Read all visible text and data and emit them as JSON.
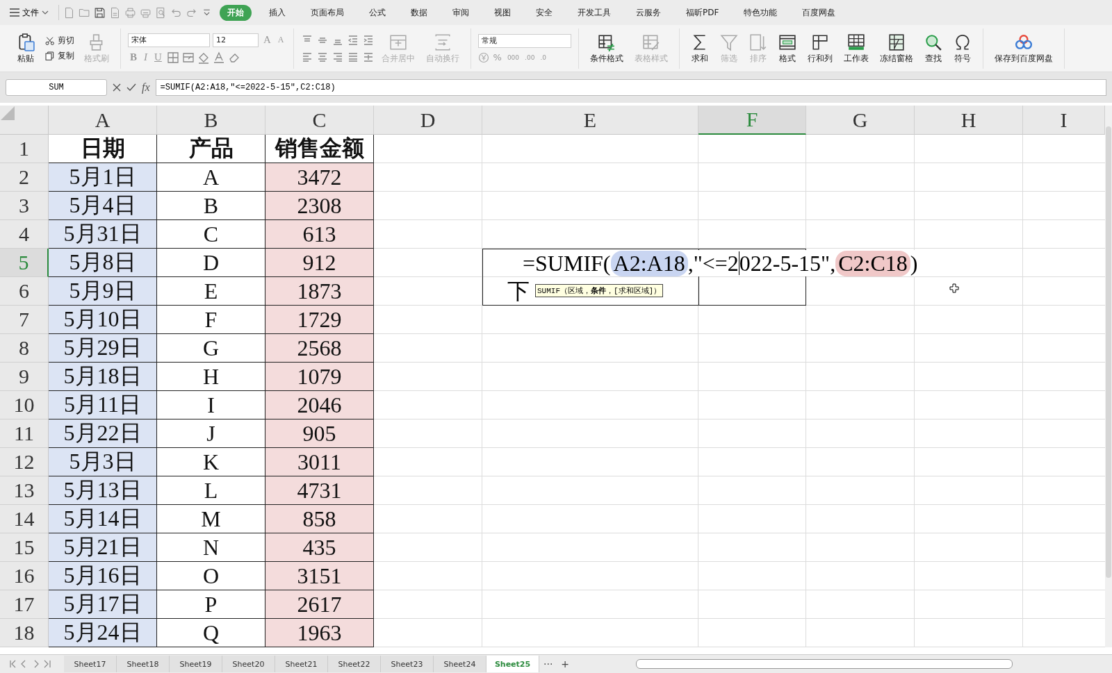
{
  "menu_bar": {
    "file_menu": "文件",
    "tabs": [
      {
        "label": "开始",
        "selected": true
      },
      {
        "label": "插入",
        "selected": false
      },
      {
        "label": "页面布局",
        "selected": false
      },
      {
        "label": "公式",
        "selected": false
      },
      {
        "label": "数据",
        "selected": false
      },
      {
        "label": "审阅",
        "selected": false
      },
      {
        "label": "视图",
        "selected": false
      },
      {
        "label": "安全",
        "selected": false
      },
      {
        "label": "开发工具",
        "selected": false
      },
      {
        "label": "云服务",
        "selected": false
      },
      {
        "label": "福昕PDF",
        "selected": false
      },
      {
        "label": "特色功能",
        "selected": false
      },
      {
        "label": "百度网盘",
        "selected": false
      }
    ]
  },
  "ribbon": {
    "paste": {
      "label": "粘贴",
      "kind": "paste",
      "disabled": false
    },
    "clipboard": [
      {
        "label": "剪切",
        "kind": "cut",
        "disabled": false
      },
      {
        "label": "复制",
        "kind": "copy",
        "disabled": false
      }
    ],
    "format_painter": {
      "label": "格式刷",
      "kind": "brush",
      "disabled": true
    },
    "font_name": "宋体",
    "font_size": "12",
    "grow_font": "A",
    "shrink_font": "A",
    "font_buttons": [
      {
        "label": "B",
        "kind": "bold"
      },
      {
        "label": "I",
        "kind": "italic"
      },
      {
        "label": "U",
        "kind": "underline"
      }
    ],
    "merge": [
      {
        "label": "合并居中",
        "kind": "merge",
        "disabled": true
      },
      {
        "label": "自动换行",
        "kind": "wrap",
        "disabled": true
      }
    ],
    "number_format": "常规",
    "percent": "%",
    "thousands": "000",
    "decimals_add": ".00",
    "decimals_remove": ".0",
    "big_buttons": [
      {
        "label": "条件格式",
        "kind": "condformat",
        "disabled": false
      },
      {
        "label": "表格样式",
        "kind": "tablestyle",
        "disabled": true
      },
      {
        "label": "求和",
        "kind": "sum",
        "disabled": false
      },
      {
        "label": "筛选",
        "kind": "filter",
        "disabled": true
      },
      {
        "label": "排序",
        "kind": "sort",
        "disabled": true
      },
      {
        "label": "格式",
        "kind": "format",
        "disabled": false
      },
      {
        "label": "行和列",
        "kind": "rowcol",
        "disabled": false
      },
      {
        "label": "工作表",
        "kind": "sheet",
        "disabled": false
      },
      {
        "label": "冻结窗格",
        "kind": "freeze",
        "disabled": false
      },
      {
        "label": "查找",
        "kind": "find",
        "disabled": false
      },
      {
        "label": "符号",
        "kind": "symbol",
        "disabled": false
      }
    ],
    "cloud_save": {
      "label": "保存到百度网盘",
      "kind": "cloud",
      "disabled": false
    }
  },
  "formula_bar": {
    "name_box": "SUM",
    "fx": "fx",
    "formula": "=SUMIF(A2:A18,\"<=2022-5-15\",C2:C18)"
  },
  "sheet": {
    "columns": [
      {
        "label": "A",
        "selected": false,
        "color": "#dce4f4"
      },
      {
        "label": "B",
        "selected": false
      },
      {
        "label": "C",
        "selected": false,
        "color": "#f4dcdc"
      },
      {
        "label": "D",
        "selected": false
      },
      {
        "label": "E",
        "selected": false
      },
      {
        "label": "F",
        "selected": true
      },
      {
        "label": "G",
        "selected": false
      },
      {
        "label": "H",
        "selected": false
      },
      {
        "label": "I",
        "selected": false
      }
    ],
    "rows": [
      {
        "number": "1",
        "selected": false,
        "cells": [
          "日期",
          "产品",
          "销售金额"
        ]
      },
      {
        "number": "2",
        "selected": false,
        "cells": [
          "5月1日",
          "A",
          "3472"
        ]
      },
      {
        "number": "3",
        "selected": false,
        "cells": [
          "5月4日",
          "B",
          "2308"
        ]
      },
      {
        "number": "4",
        "selected": false,
        "cells": [
          "5月31日",
          "C",
          "613"
        ]
      },
      {
        "number": "5",
        "selected": true,
        "cells": [
          "5月8日",
          "D",
          "912"
        ]
      },
      {
        "number": "6",
        "selected": false,
        "cells": [
          "5月9日",
          "E",
          "1873"
        ]
      },
      {
        "number": "7",
        "selected": false,
        "cells": [
          "5月10日",
          "F",
          "1729"
        ]
      },
      {
        "number": "8",
        "selected": false,
        "cells": [
          "5月29日",
          "G",
          "2568"
        ]
      },
      {
        "number": "9",
        "selected": false,
        "cells": [
          "5月18日",
          "H",
          "1079"
        ]
      },
      {
        "number": "10",
        "selected": false,
        "cells": [
          "5月11日",
          "I",
          "2046"
        ]
      },
      {
        "number": "11",
        "selected": false,
        "cells": [
          "5月22日",
          "J",
          "905"
        ]
      },
      {
        "number": "12",
        "selected": false,
        "cells": [
          "5月3日",
          "K",
          "3011"
        ]
      },
      {
        "number": "13",
        "selected": false,
        "cells": [
          "5月13日",
          "L",
          "4731"
        ]
      },
      {
        "number": "14",
        "selected": false,
        "cells": [
          "5月14日",
          "M",
          "858"
        ]
      },
      {
        "number": "15",
        "selected": false,
        "cells": [
          "5月21日",
          "N",
          "435"
        ]
      },
      {
        "number": "16",
        "selected": false,
        "cells": [
          "5月16日",
          "O",
          "3151"
        ]
      },
      {
        "number": "17",
        "selected": false,
        "cells": [
          "5月17日",
          "P",
          "2617"
        ]
      },
      {
        "number": "18",
        "selected": false,
        "cells": [
          "5月24日",
          "Q",
          "1963"
        ]
      }
    ],
    "editor": [
      {
        "kind": "text",
        "text": "=SUMIF("
      },
      {
        "kind": "range",
        "text": "A2:A18",
        "color": "#c9d5f1"
      },
      {
        "kind": "text",
        "text": ",\"<=2"
      },
      {
        "kind": "caret"
      },
      {
        "kind": "text",
        "text": "022-5-15\","
      },
      {
        "kind": "range",
        "text": "C2:C18",
        "color": "#f0c8c8"
      },
      {
        "kind": "text",
        "text": ")"
      }
    ],
    "e6_label": "下",
    "tooltip": "SUMIF（区域，**条件**，[求和区域]）"
  },
  "sheet_tabs": {
    "tabs": [
      {
        "label": "Sheet17",
        "selected": false
      },
      {
        "label": "Sheet18",
        "selected": false
      },
      {
        "label": "Sheet19",
        "selected": false
      },
      {
        "label": "Sheet20",
        "selected": false
      },
      {
        "label": "Sheet21",
        "selected": false
      },
      {
        "label": "Sheet22",
        "selected": false
      },
      {
        "label": "Sheet23",
        "selected": false
      },
      {
        "label": "Sheet24",
        "selected": false
      },
      {
        "label": "Sheet25",
        "selected": true
      }
    ],
    "more": "···",
    "add": "+"
  }
}
